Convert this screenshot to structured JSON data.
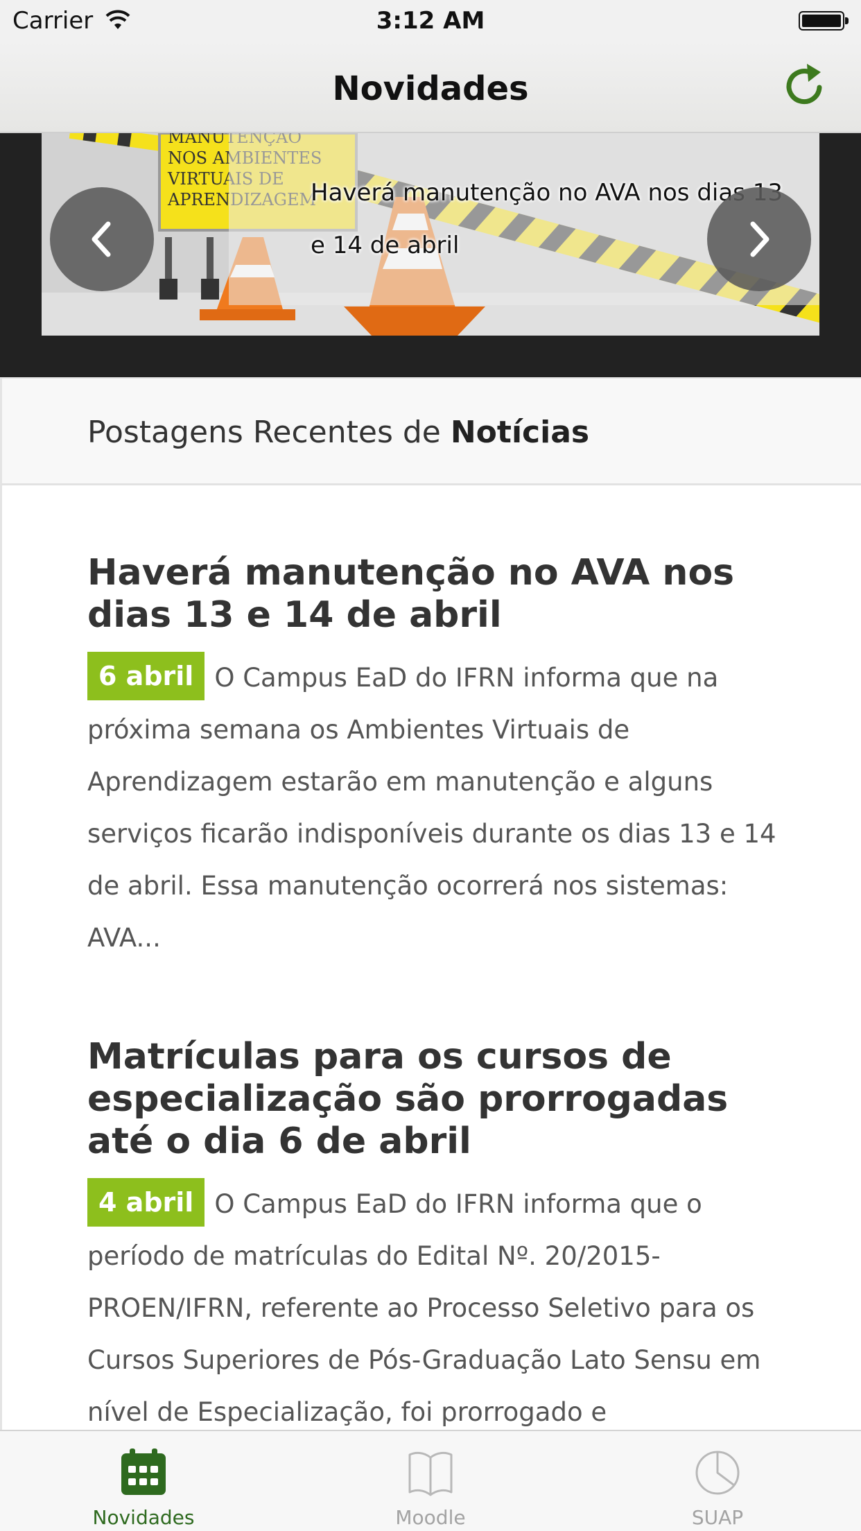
{
  "status_bar": {
    "carrier": "Carrier",
    "time": "3:12 AM"
  },
  "nav": {
    "title": "Novidades",
    "refresh_icon": "refresh-icon",
    "accent_color": "#3d7a1e"
  },
  "carousel": {
    "caption": "Haverá manutenção no AVA nos dias 13 e 14 de abril",
    "sign_text": "MANUTENÇÃO NOS AMBIENTES VIRTUAIS DE APRENDIZAGEM",
    "prev_icon": "chevron-left-icon",
    "next_icon": "chevron-right-icon"
  },
  "section": {
    "title_prefix": "Postagens Recentes de ",
    "title_bold": "Notícias"
  },
  "posts": [
    {
      "title": "Haverá manutenção no AVA nos dias 13 e 14 de abril",
      "date": "6 abril",
      "excerpt": "O Campus EaD do IFRN informa que na próxima semana os Ambientes Virtuais de Aprendizagem estarão em manutenção e alguns serviços ficarão indisponíveis durante os dias 13 e 14 de abril. Essa manutenção ocorrerá nos sistemas: AVA..."
    },
    {
      "title": "Matrículas para os cursos de especialização são prorrogadas até o dia 6 de abril",
      "date": "4 abril",
      "excerpt": "O Campus EaD do IFRN informa que o período de matrículas do Edital Nº. 20/2015-PROEN/IFRN, referente ao Processo Seletivo para os Cursos Superiores de Pós-Graduação Lato Sensu em nível de Especialização, foi prorrogado e"
    }
  ],
  "date_badge_color": "#8dbf1d",
  "tab_bar": {
    "tabs": [
      {
        "label": "Novidades",
        "icon": "calendar-icon",
        "active": true
      },
      {
        "label": "Moodle",
        "icon": "book-icon",
        "active": false
      },
      {
        "label": "SUAP",
        "icon": "pie-chart-icon",
        "active": false
      }
    ]
  }
}
